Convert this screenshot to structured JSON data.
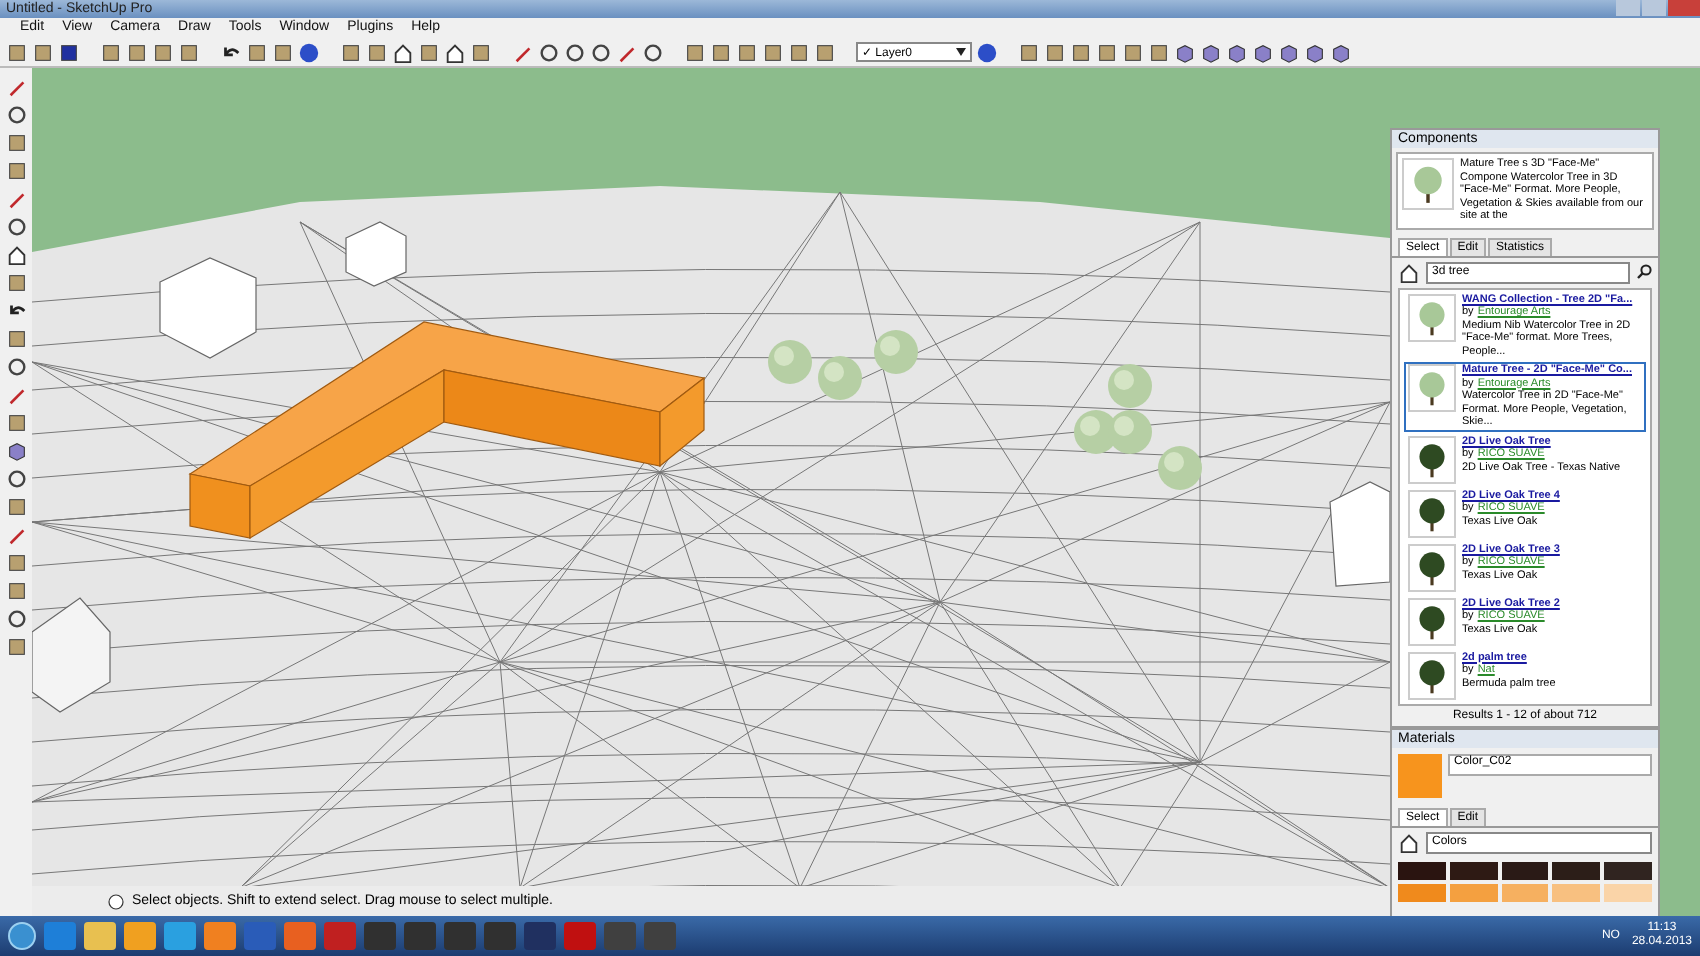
{
  "window": {
    "title": "Untitled - SketchUp Pro"
  },
  "menu": [
    "Edit",
    "View",
    "Camera",
    "Draw",
    "Tools",
    "Window",
    "Plugins",
    "Help"
  ],
  "toolbar": {
    "layer_check": "✓",
    "layer": "Layer0"
  },
  "components": {
    "title": "Components",
    "preview_title": "Mature Tree s 3D \"Face-Me\" Compone",
    "preview_description": "Watercolor Tree in 3D \"Face-Me\" Format. More People, Vegetation & Skies available from our site at the",
    "tabs": [
      {
        "label": "Select",
        "selected": true
      },
      {
        "label": "Edit",
        "selected": false
      },
      {
        "label": "Statistics",
        "selected": false
      }
    ],
    "search": "3d tree",
    "results": [
      {
        "title": "WANG Collection - Tree 2D \"Fa...",
        "by": "by",
        "author": "Entourage Arts",
        "description": "Medium Nib Watercolor Tree in 2D \"Face-Me\" format. More Trees, People...",
        "selected": false
      },
      {
        "title": "Mature Tree - 2D \"Face-Me\" Co...",
        "by": "by",
        "author": "Entourage Arts",
        "description": "Watercolor Tree in 2D \"Face-Me\" Format. More People, Vegetation, Skie...",
        "selected": true
      },
      {
        "title": "2D Live Oak Tree",
        "by": "by",
        "author": "RICO SUAVE",
        "description": "2D Live Oak Tree - Texas Native",
        "selected": false
      },
      {
        "title": "2D Live Oak Tree 4",
        "by": "by",
        "author": "RICO SUAVE",
        "description": "Texas Live Oak",
        "selected": false
      },
      {
        "title": "2D Live Oak Tree 3",
        "by": "by",
        "author": "RICO SUAVE",
        "description": "Texas Live Oak",
        "selected": false
      },
      {
        "title": "2D Live Oak Tree 2",
        "by": "by",
        "author": "RICO SUAVE",
        "description": "Texas Live Oak",
        "selected": false
      },
      {
        "title": "2d palm tree",
        "by": "by",
        "author": "Nat",
        "description": "Bermuda palm tree",
        "selected": false
      }
    ],
    "footer": "Results 1 - 12 of about 712"
  },
  "materials": {
    "title": "Materials",
    "name": "Color_C02",
    "tabs": [
      {
        "label": "Select",
        "selected": true
      },
      {
        "label": "Edit",
        "selected": false
      }
    ],
    "library": "Colors",
    "swatches": [
      {
        "color": "#2a1410"
      },
      {
        "color": "#2e1a14"
      },
      {
        "color": "#2a1a16"
      },
      {
        "color": "#2c1e18"
      },
      {
        "color": "#302420"
      },
      {
        "color": "#f08a1c"
      },
      {
        "color": "#f4a040"
      },
      {
        "color": "#f6b060"
      },
      {
        "color": "#f8c080"
      },
      {
        "color": "#fad4a8"
      }
    ]
  },
  "status_bar": {
    "text": "Select objects. Shift to extend select. Drag mouse to select multiple."
  },
  "taskbar": {
    "language": "NO",
    "time": "11:13",
    "date": "28.04.2013"
  }
}
